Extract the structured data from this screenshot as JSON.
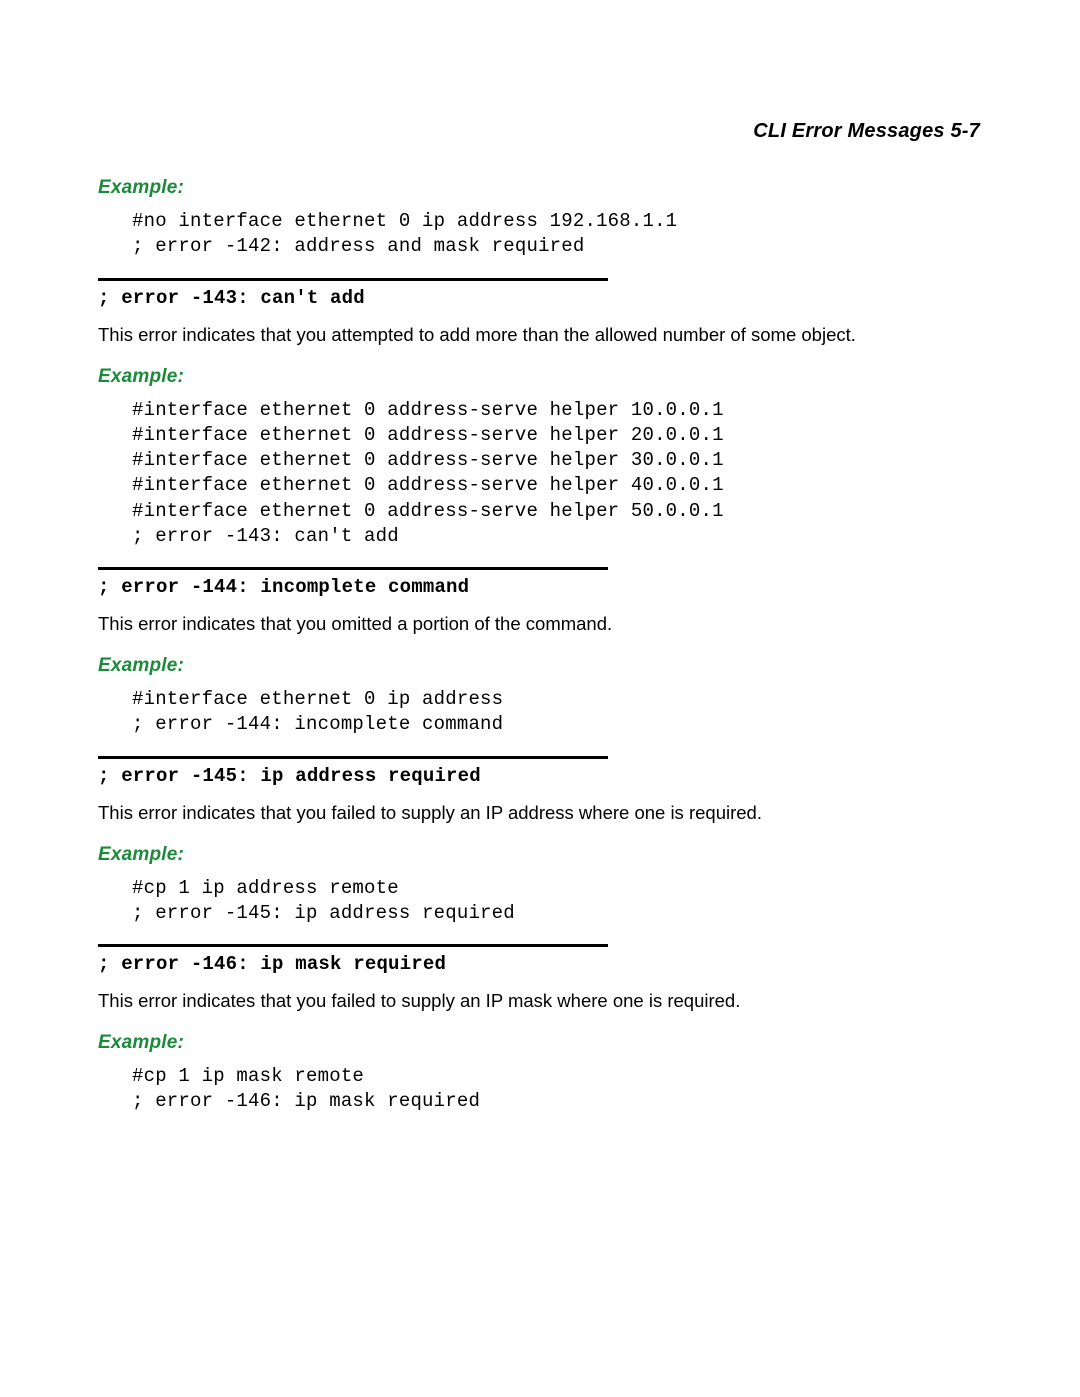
{
  "header": {
    "title": "CLI Error Messages   5-7"
  },
  "labels": {
    "example": "Example:"
  },
  "sections": [
    {
      "code": "#no interface ethernet 0 ip address 192.168.1.1\n; error -142: address and mask required"
    },
    {
      "heading": "; error -143: can't add",
      "body": "This error indicates that you attempted to add more than the allowed number of some object.",
      "code": "#interface ethernet 0 address-serve helper 10.0.0.1\n#interface ethernet 0 address-serve helper 20.0.0.1\n#interface ethernet 0 address-serve helper 30.0.0.1\n#interface ethernet 0 address-serve helper 40.0.0.1\n#interface ethernet 0 address-serve helper 50.0.0.1\n; error -143: can't add"
    },
    {
      "heading": "; error -144: incomplete command",
      "body": "This error indicates that you omitted a portion of the command.",
      "code": "#interface ethernet 0 ip address\n; error -144: incomplete command"
    },
    {
      "heading": "; error -145: ip address required",
      "body": "This error indicates that you failed to supply an IP address where one is required.",
      "code": "#cp 1 ip address remote\n; error -145: ip address required"
    },
    {
      "heading": "; error -146: ip mask required",
      "body": "This error indicates that you failed to supply an IP mask where one is required.",
      "code": "#cp 1 ip mask remote\n; error -146: ip mask required"
    }
  ]
}
